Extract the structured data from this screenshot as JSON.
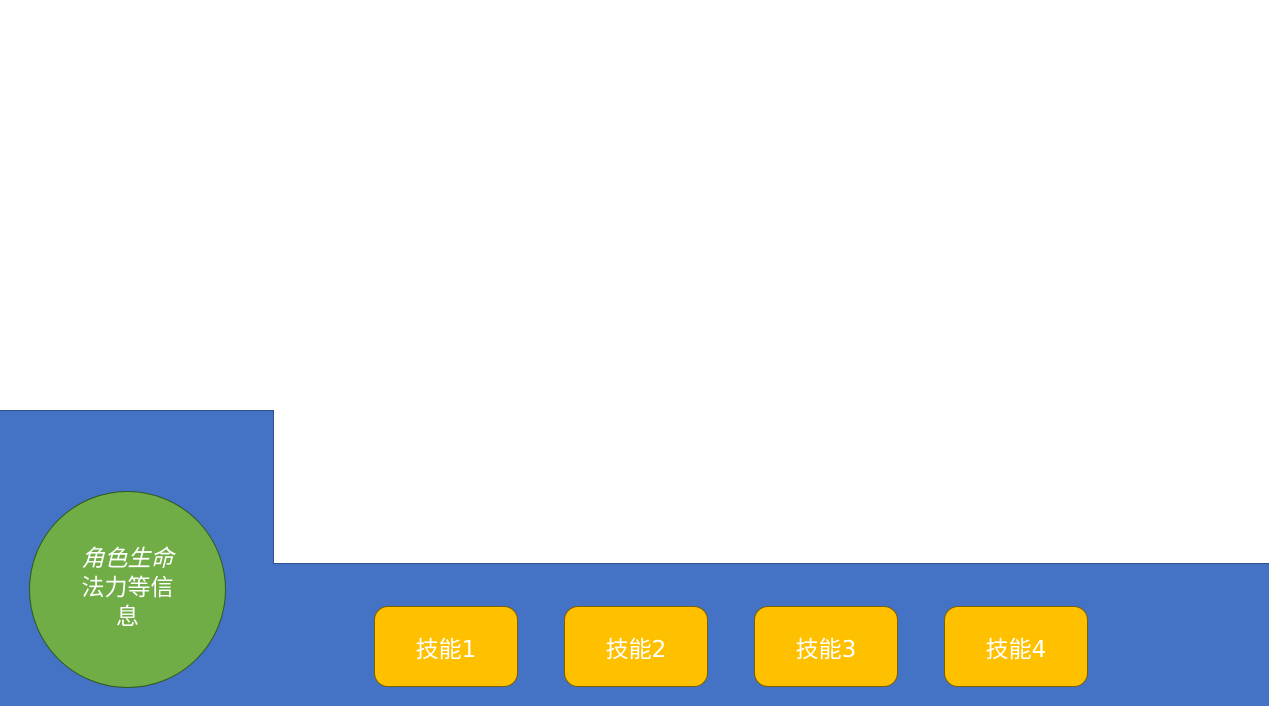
{
  "colors": {
    "panel": "#4472c4",
    "orb": "#70ad47",
    "skill": "#ffc000",
    "text": "#ffffff"
  },
  "status": {
    "line1": "角色生命",
    "line2": "法力等信",
    "line3": "息"
  },
  "skills": [
    {
      "label": "技能1"
    },
    {
      "label": "技能2"
    },
    {
      "label": "技能3"
    },
    {
      "label": "技能4"
    }
  ]
}
